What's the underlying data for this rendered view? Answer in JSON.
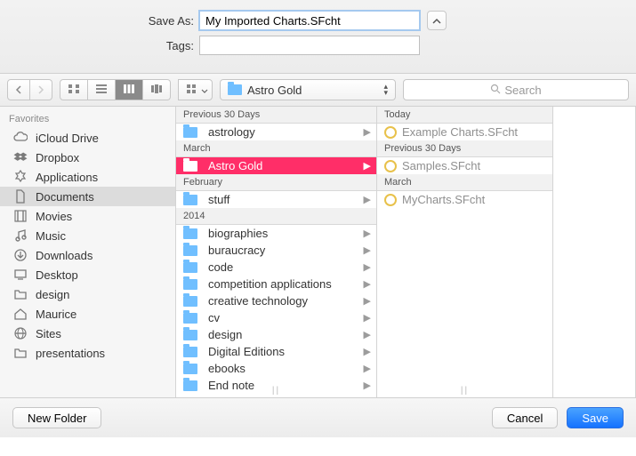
{
  "fields": {
    "saveas_label": "Save As:",
    "saveas_value": "My Imported Charts.SFcht",
    "tags_label": "Tags:",
    "tags_value": ""
  },
  "toolbar": {
    "path_label": "Astro Gold",
    "search_placeholder": "Search"
  },
  "sidebar": {
    "header": "Favorites",
    "items": [
      {
        "label": "iCloud Drive",
        "icon": "cloud"
      },
      {
        "label": "Dropbox",
        "icon": "dropbox"
      },
      {
        "label": "Applications",
        "icon": "apps"
      },
      {
        "label": "Documents",
        "icon": "doc",
        "selected": true
      },
      {
        "label": "Movies",
        "icon": "film"
      },
      {
        "label": "Music",
        "icon": "music"
      },
      {
        "label": "Downloads",
        "icon": "download"
      },
      {
        "label": "Desktop",
        "icon": "desktop"
      },
      {
        "label": "design",
        "icon": "folder"
      },
      {
        "label": "Maurice",
        "icon": "home"
      },
      {
        "label": "Sites",
        "icon": "globe"
      },
      {
        "label": "presentations",
        "icon": "folder"
      }
    ]
  },
  "col1": {
    "sections": [
      {
        "header": "Previous 30 Days",
        "rows": [
          {
            "label": "astrology",
            "type": "folder"
          }
        ]
      },
      {
        "header": "March",
        "rows": [
          {
            "label": "Astro Gold",
            "type": "folder",
            "selected": true
          }
        ]
      },
      {
        "header": "February",
        "rows": [
          {
            "label": "stuff",
            "type": "folder"
          }
        ]
      },
      {
        "header": "2014",
        "rows": [
          {
            "label": "biographies",
            "type": "folder"
          },
          {
            "label": "buraucracy",
            "type": "folder"
          },
          {
            "label": "code",
            "type": "folder"
          },
          {
            "label": "competition applications",
            "type": "folder"
          },
          {
            "label": "creative technology",
            "type": "folder"
          },
          {
            "label": "cv",
            "type": "folder"
          },
          {
            "label": "design",
            "type": "folder"
          },
          {
            "label": "Digital Editions",
            "type": "folder"
          },
          {
            "label": "ebooks",
            "type": "folder"
          },
          {
            "label": "End note",
            "type": "folder"
          }
        ]
      }
    ]
  },
  "col2": {
    "sections": [
      {
        "header": "Today",
        "rows": [
          {
            "label": "Example Charts.SFcht",
            "type": "file",
            "dim": true
          }
        ]
      },
      {
        "header": "Previous 30 Days",
        "rows": [
          {
            "label": "Samples.SFcht",
            "type": "file",
            "dim": true
          }
        ]
      },
      {
        "header": "March",
        "rows": [
          {
            "label": "MyCharts.SFcht",
            "type": "file",
            "dim": true
          }
        ]
      }
    ]
  },
  "footer": {
    "new_folder": "New Folder",
    "cancel": "Cancel",
    "save": "Save"
  }
}
